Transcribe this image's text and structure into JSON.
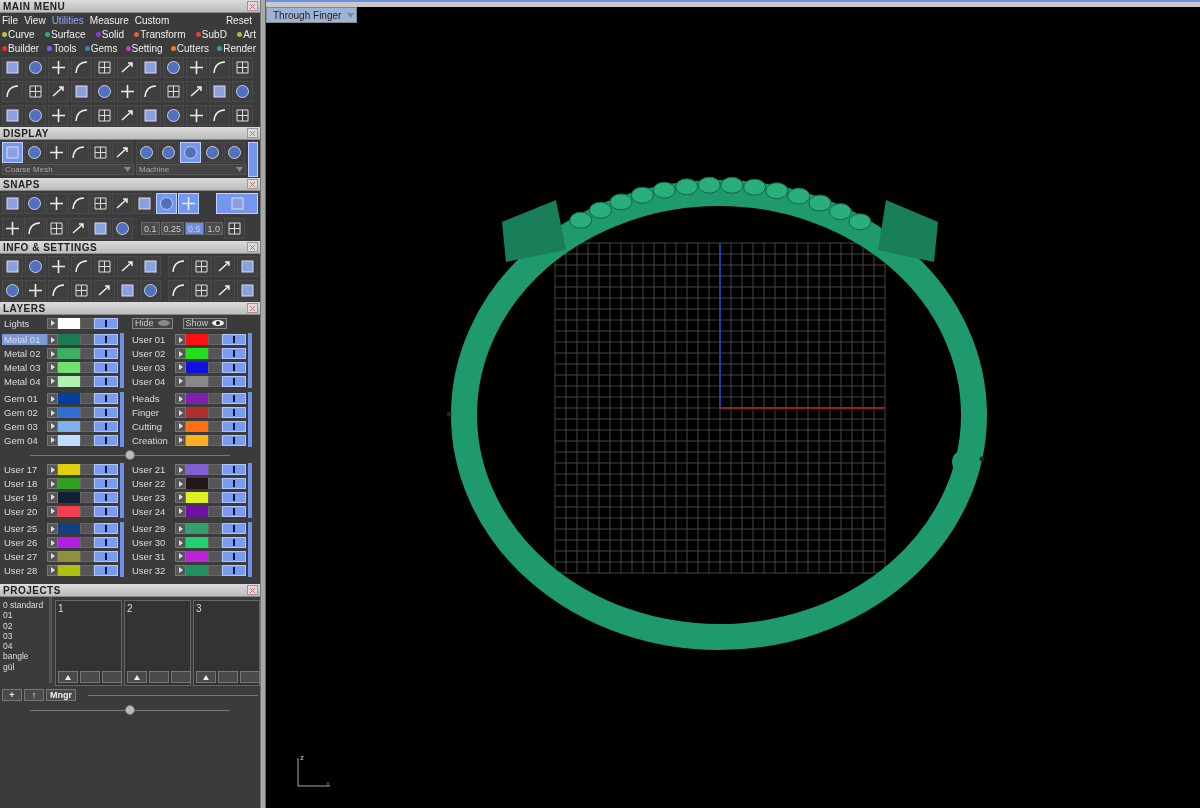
{
  "main_menu": {
    "title": "MAIN MENU",
    "menu": [
      {
        "label": "File",
        "selected": false
      },
      {
        "label": "View",
        "selected": false
      },
      {
        "label": "Utilities",
        "selected": true
      },
      {
        "label": "Measure",
        "selected": false
      },
      {
        "label": "Custom",
        "selected": false
      }
    ],
    "reset": "Reset",
    "categories": [
      {
        "label": "Curve",
        "color": "#c0c040"
      },
      {
        "label": "Surface",
        "color": "#40a080"
      },
      {
        "label": "Solid",
        "color": "#8040e0"
      },
      {
        "label": "Transform",
        "color": "#e06030"
      },
      {
        "label": "SubD",
        "color": "#e04030"
      },
      {
        "label": "Art",
        "color": "#a0c040"
      },
      {
        "label": "Builder",
        "color": "#e03040"
      },
      {
        "label": "Tools",
        "color": "#8060e0"
      },
      {
        "label": "Gems",
        "color": "#4080c0"
      },
      {
        "label": "Setting",
        "color": "#c040c0"
      },
      {
        "label": "Cutters",
        "color": "#f08020"
      },
      {
        "label": "Render",
        "color": "#30a0a0"
      }
    ]
  },
  "display": {
    "title": "DISPLAY",
    "view_modes": [
      {
        "selected": true
      },
      {
        "selected": false
      },
      {
        "selected": false
      },
      {
        "selected": false
      },
      {
        "selected": false
      },
      {
        "selected": false
      }
    ],
    "materials": [
      {
        "selected": false
      },
      {
        "selected": false
      },
      {
        "selected": true
      },
      {
        "selected": false
      },
      {
        "selected": false
      }
    ],
    "mesh": "Coarse Mesh",
    "material": "Machine"
  },
  "snaps": {
    "title": "SNAPS",
    "snap_buttons": [
      {
        "selected": false
      },
      {
        "selected": false
      },
      {
        "selected": false
      },
      {
        "selected": false
      },
      {
        "selected": false
      },
      {
        "selected": false
      },
      {
        "selected": false
      },
      {
        "selected": true
      },
      {
        "selected": true
      }
    ],
    "grid_steps": [
      {
        "label": "0.1",
        "selected": false
      },
      {
        "label": "0.25",
        "selected": false
      },
      {
        "label": "0.5",
        "selected": true
      },
      {
        "label": "1.0",
        "selected": false
      }
    ]
  },
  "info": {
    "title": "INFO & SETTINGS"
  },
  "layers": {
    "title": "LAYERS",
    "lights": {
      "name": "Lights",
      "color": "#ffffff"
    },
    "hide": "Hide",
    "show": "Show",
    "groups": [
      {
        "left": [
          {
            "name": "Metal 01",
            "color": "#1a7a50",
            "selected": true
          },
          {
            "name": "Metal 02",
            "color": "#3cb060",
            "selected": false
          },
          {
            "name": "Metal 03",
            "color": "#70e070",
            "selected": false
          },
          {
            "name": "Metal 04",
            "color": "#b0f0b0",
            "selected": false
          }
        ],
        "right": [
          {
            "name": "User 01",
            "color": "#ff1010",
            "selected": false
          },
          {
            "name": "User 02",
            "color": "#20e020",
            "selected": false
          },
          {
            "name": "User 03",
            "color": "#1010e0",
            "selected": false
          },
          {
            "name": "User 04",
            "color": "#888888",
            "selected": false
          }
        ]
      },
      {
        "left": [
          {
            "name": "Gem 01",
            "color": "#0040a0",
            "selected": false
          },
          {
            "name": "Gem 02",
            "color": "#3070d0",
            "selected": false
          },
          {
            "name": "Gem 03",
            "color": "#80b0f0",
            "selected": false
          },
          {
            "name": "Gem 04",
            "color": "#c0dcff",
            "selected": false
          }
        ],
        "right": [
          {
            "name": "Heads",
            "color": "#8020b0",
            "selected": false
          },
          {
            "name": "Finger",
            "color": "#b03030",
            "selected": false
          },
          {
            "name": "Cutting",
            "color": "#ff7010",
            "selected": false
          },
          {
            "name": "Creation",
            "color": "#ffb020",
            "selected": false
          }
        ]
      },
      {
        "left": [
          {
            "name": "User 17",
            "color": "#e0d010",
            "selected": false
          },
          {
            "name": "User 18",
            "color": "#30a020",
            "selected": false
          },
          {
            "name": "User 19",
            "color": "#102030",
            "selected": false
          },
          {
            "name": "User 20",
            "color": "#f04050",
            "selected": false
          }
        ],
        "right": [
          {
            "name": "User 21",
            "color": "#8060d0",
            "selected": false
          },
          {
            "name": "User 22",
            "color": "#201818",
            "selected": false
          },
          {
            "name": "User 23",
            "color": "#e0f020",
            "selected": false
          },
          {
            "name": "User 24",
            "color": "#7010a0",
            "selected": false
          }
        ]
      },
      {
        "left": [
          {
            "name": "User 25",
            "color": "#104080",
            "selected": false
          },
          {
            "name": "User 26",
            "color": "#b020e0",
            "selected": false
          },
          {
            "name": "User 27",
            "color": "#909040",
            "selected": false
          },
          {
            "name": "User 28",
            "color": "#b0c010",
            "selected": false
          }
        ],
        "right": [
          {
            "name": "User 29",
            "color": "#30a070",
            "selected": false
          },
          {
            "name": "User 30",
            "color": "#20d070",
            "selected": false
          },
          {
            "name": "User 31",
            "color": "#c020e0",
            "selected": false
          },
          {
            "name": "User 32",
            "color": "#209060",
            "selected": false
          }
        ]
      }
    ]
  },
  "projects": {
    "title": "PROJECTS",
    "list": [
      "0 standard",
      "01",
      "02",
      "03",
      "04",
      "bangle",
      "gül"
    ],
    "buttons": [
      "+",
      "↑",
      "Mngr"
    ],
    "slots": [
      "1",
      "2",
      "3"
    ]
  },
  "viewport": {
    "snap_mode": "Through Finger",
    "axis_labels": [
      "z",
      "x"
    ]
  }
}
